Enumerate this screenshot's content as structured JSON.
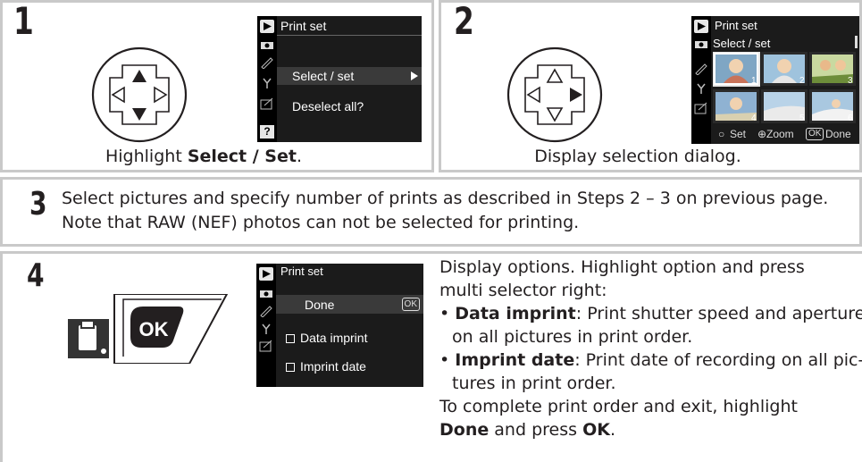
{
  "steps": {
    "s1": {
      "num": "1",
      "caption_pre": "Highlight ",
      "caption_bold": "Select / Set",
      "caption_post": ".",
      "menu": {
        "title": "Print set",
        "item1": "Select / set",
        "item2": "Deselect all?",
        "help": "?"
      }
    },
    "s2": {
      "num": "2",
      "caption": "Display selection dialog.",
      "menu": {
        "title": "Print set",
        "subtitle": "Select / set",
        "thumbs": [
          "1",
          "2",
          "3",
          "4",
          "5",
          "6"
        ],
        "footer_set": "Set",
        "footer_zoom": "Zoom",
        "footer_ok": "OK",
        "footer_done": "Done"
      }
    },
    "s3": {
      "num": "3",
      "line1": "Select pictures and specify number of prints as described in Steps 2 – 3 on previous page.",
      "line2": "Note that RAW (NEF) photos can not be selected for printing."
    },
    "s4": {
      "num": "4",
      "button_label": "OK",
      "menu": {
        "title": "Print set",
        "done": "Done",
        "ok": "OK",
        "opt1": "Data imprint",
        "opt2": "Imprint date"
      },
      "intro1": "Display options.  Highlight option and press",
      "intro2": "multi selector right:",
      "b1_term": "Data imprint",
      "b1_text": ": Print shutter speed and aperture",
      "b1_cont": "on all pictures in print order.",
      "b2_term": "Imprint date",
      "b2_text": ": Print date of recording on all pic-",
      "b2_cont": "tures in print order.",
      "end1": "To complete print order and exit, highlight",
      "end2_bold": "Done",
      "end2_mid": " and press ",
      "end2_bold2": "OK",
      "end2_post": "."
    }
  },
  "colors": {
    "border": "#c9c9c9",
    "screen": "#1b1b1b",
    "highlight": "#3a3a3a"
  }
}
